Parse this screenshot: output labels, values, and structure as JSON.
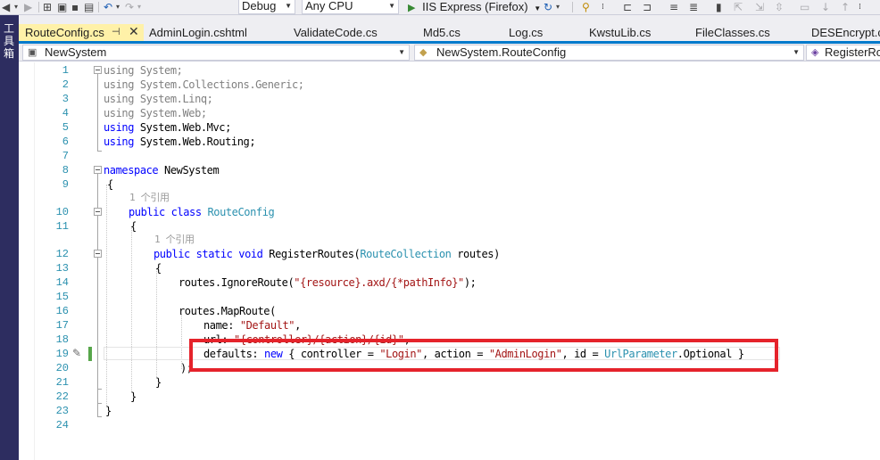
{
  "toolbar": {
    "configuration": "Debug",
    "platform": "Any CPU",
    "run_target": "IIS Express (Firefox)"
  },
  "left_panel": {
    "label": "工具箱"
  },
  "tabs": [
    {
      "label": "RouteConfig.cs",
      "active": true,
      "pinned": true
    },
    {
      "label": "AdminLogin.cshtml"
    },
    {
      "label": "ValidateCode.cs"
    },
    {
      "label": "Md5.cs"
    },
    {
      "label": "Log.cs"
    },
    {
      "label": "KwstuLib.cs"
    },
    {
      "label": "FileClasses.cs"
    },
    {
      "label": "DESEncrypt.cs"
    }
  ],
  "navbar": {
    "project": "NewSystem",
    "type": "NewSystem.RouteConfig",
    "member": "RegisterRoutes"
  },
  "code": {
    "line_numbers": [
      "1",
      "2",
      "3",
      "4",
      "5",
      "6",
      "7",
      "8",
      "9",
      "10",
      "11",
      "12",
      "13",
      "14",
      "15",
      "16",
      "17",
      "18",
      "19",
      "20",
      "21",
      "22",
      "23",
      "24"
    ],
    "codelens": [
      "1 个引用",
      "1 个引用"
    ],
    "l1": [
      "using",
      " System;"
    ],
    "l2": [
      "using",
      " System.Collections.Generic;"
    ],
    "l3": [
      "using",
      " System.Linq;"
    ],
    "l4": [
      "using",
      " System.Web;"
    ],
    "l5": [
      "using",
      " System.Web.Mvc;"
    ],
    "l6": [
      "using",
      " System.Web.Routing;"
    ],
    "l8": [
      "namespace",
      " NewSystem"
    ],
    "l9": "{",
    "l10": [
      "public class",
      " ",
      "RouteConfig"
    ],
    "l11": "{",
    "l12": [
      "public static void",
      " RegisterRoutes(",
      "RouteCollection",
      " routes)"
    ],
    "l13": "{",
    "l14": [
      "routes.IgnoreRoute(",
      "\"{resource}.axd/{*pathInfo}\"",
      ");"
    ],
    "l16": "routes.MapRoute(",
    "l17": [
      "name: ",
      "\"Default\"",
      ","
    ],
    "l18": [
      "url: ",
      "\"{controller}/{action}/{id}\"",
      ","
    ],
    "l19": [
      "defaults: ",
      "new",
      " { controller = ",
      "\"Login\"",
      ", action = ",
      "\"AdminLogin\"",
      ", id = ",
      "UrlParameter",
      ".Optional }"
    ],
    "l20": ");",
    "l21": "}",
    "l22": "}",
    "l23": "}"
  },
  "colors": {
    "keyword": "#0000ff",
    "type": "#2b91af",
    "string": "#a31515",
    "line_number": "#2b91af",
    "highlight_box": "#e5232b",
    "active_tab": "#fff1a8",
    "tab_underline": "#007acc"
  },
  "icons": [
    "back-arrow-icon",
    "forward-arrow-icon",
    "new-project-icon",
    "open-file-icon",
    "save-icon",
    "save-all-icon",
    "undo-icon",
    "redo-icon",
    "run-icon",
    "refresh-icon",
    "find-icon",
    "bookmark-icon",
    "pin-icon",
    "close-icon",
    "pencil-icon"
  ]
}
